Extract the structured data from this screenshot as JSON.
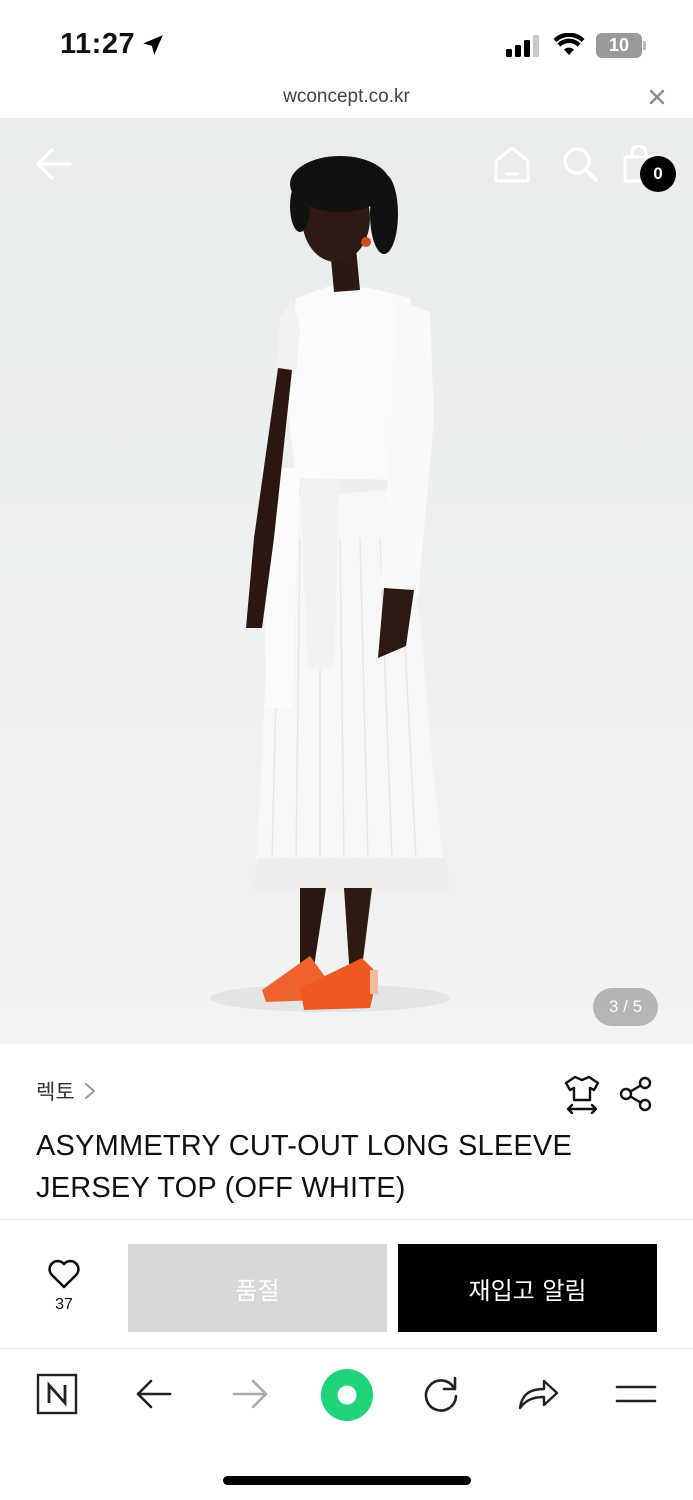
{
  "status_bar": {
    "time": "11:27",
    "battery": "10"
  },
  "url_bar": {
    "domain": "wconcept.co.kr"
  },
  "gallery": {
    "cart_count": "0",
    "current_index": "3",
    "total": "5",
    "counter": "3 / 5"
  },
  "product": {
    "brand": "렉토",
    "title": "ASYMMETRY CUT-OUT LONG SLEEVE JERSEY TOP (OFF WHITE)"
  },
  "actions": {
    "like_count": "37",
    "soldout_label": "품절",
    "restock_label": "재입고 알림"
  },
  "icons": {
    "nav": [
      "back-arrow-icon",
      "home-icon",
      "search-icon",
      "shopping-bag-icon"
    ],
    "product": [
      "size-guide-icon",
      "share-icon",
      "chevron-right-icon",
      "heart-icon"
    ],
    "toolbar": [
      "naver-icon",
      "back-icon",
      "forward-icon",
      "green-dot-icon",
      "reload-icon",
      "share-arrow-icon",
      "menu-icon"
    ]
  },
  "colors": {
    "soldout_bg": "#d8d8d8",
    "restock_bg": "#000000",
    "badge_bg": "#000000",
    "toolbar_green": "#1ed37a",
    "battery_low": "#e5413a"
  }
}
